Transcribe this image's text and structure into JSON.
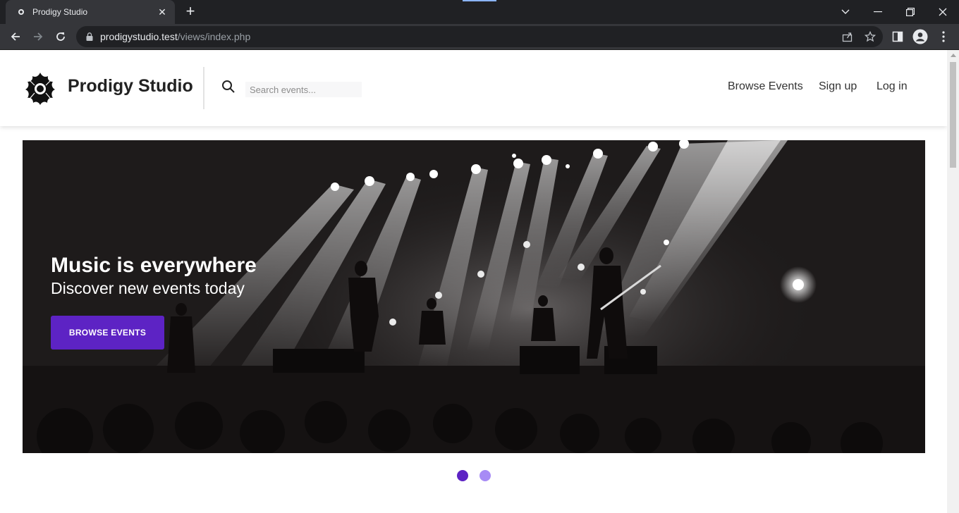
{
  "browser": {
    "tab": {
      "title": "Prodigy Studio",
      "close_label": "✕"
    },
    "new_tab_label": "+",
    "url": {
      "host": "prodigystudio.test",
      "path": "/views/index.php"
    }
  },
  "header": {
    "brand": "Prodigy Studio",
    "search": {
      "placeholder": "Search events..."
    },
    "nav": [
      "Browse Events",
      "Sign up",
      "Log in"
    ]
  },
  "hero": {
    "title": "Music is everywhere",
    "subtitle": "Discover new events today",
    "button_label": "BROWSE EVENTS"
  },
  "carousel": {
    "slides": 2,
    "active_index": 0
  },
  "colors": {
    "accent": "#5d23c4",
    "dot_active": "#5d23c4",
    "dot_inactive": "#a78bf5",
    "chrome_dark": "#202124",
    "chrome_toolbar": "#35363a"
  }
}
